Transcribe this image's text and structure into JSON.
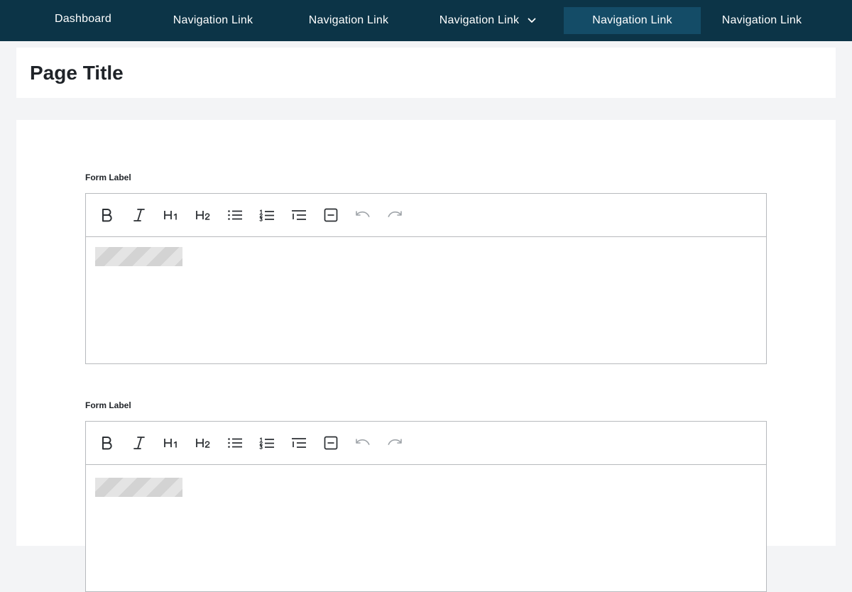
{
  "nav": {
    "items": [
      {
        "label": "Dashboard"
      },
      {
        "label": "Navigation Link"
      },
      {
        "label": "Navigation Link"
      },
      {
        "label": "Navigation Link",
        "has_dropdown": true
      },
      {
        "label": "Navigation Link",
        "active": true
      },
      {
        "label": "Navigation Link"
      }
    ],
    "colors": {
      "bar": "#0c3447",
      "active": "#144c67",
      "text": "#ffffff"
    }
  },
  "header": {
    "title": "Page Title"
  },
  "form": {
    "fields": [
      {
        "label": "Form Label"
      },
      {
        "label": "Form Label"
      }
    ],
    "toolbar": {
      "icons": [
        "bold-icon",
        "italic-icon",
        "heading-1-icon",
        "heading-2-icon",
        "bullet-list-icon",
        "numbered-list-icon",
        "indent-list-icon",
        "horizontal-rule-icon",
        "undo-icon",
        "redo-icon"
      ],
      "h1": "H1",
      "h2": "H2"
    }
  }
}
